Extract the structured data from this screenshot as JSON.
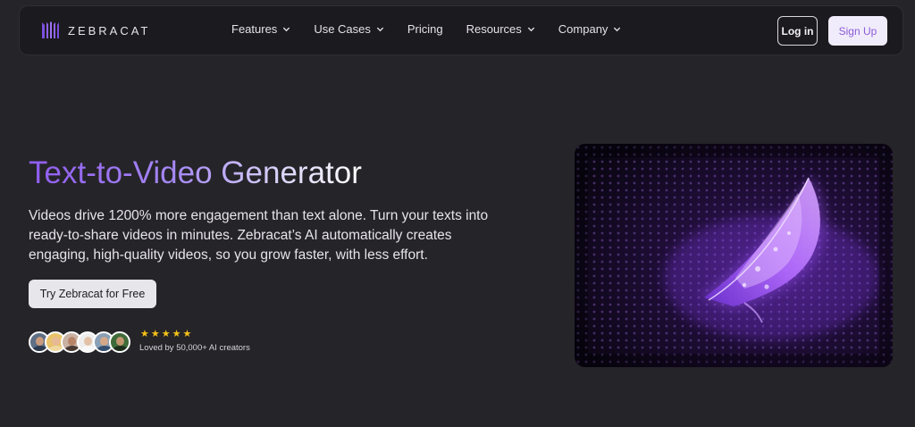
{
  "brand": {
    "name": "ZEBRACAT",
    "accent": "#8b5cf6"
  },
  "nav": {
    "items": [
      {
        "label": "Features",
        "dropdown": true
      },
      {
        "label": "Use Cases",
        "dropdown": true
      },
      {
        "label": "Pricing",
        "dropdown": false
      },
      {
        "label": "Resources",
        "dropdown": true
      },
      {
        "label": "Company",
        "dropdown": true
      }
    ],
    "login_label": "Log in",
    "signup_label": "Sign Up"
  },
  "hero": {
    "title": "Text-to-Video Generator",
    "description": "Videos drive 1200% more engagement than text alone. Turn your texts into ready-to-share videos in minutes. Zebracat’s AI automatically creates engaging, high-quality videos, so you grow faster, with less effort.",
    "cta_label": "Try Zebracat for Free",
    "rating_stars": "★★★★★",
    "rating_value": 5,
    "social_proof": "Loved by 50,000+ AI creators"
  },
  "colors": {
    "background": "#252428",
    "navbar": "#1b1a1e",
    "star": "#f5c21b",
    "signup_bg": "#f1ecfb",
    "signup_text": "#8b5bd8"
  }
}
